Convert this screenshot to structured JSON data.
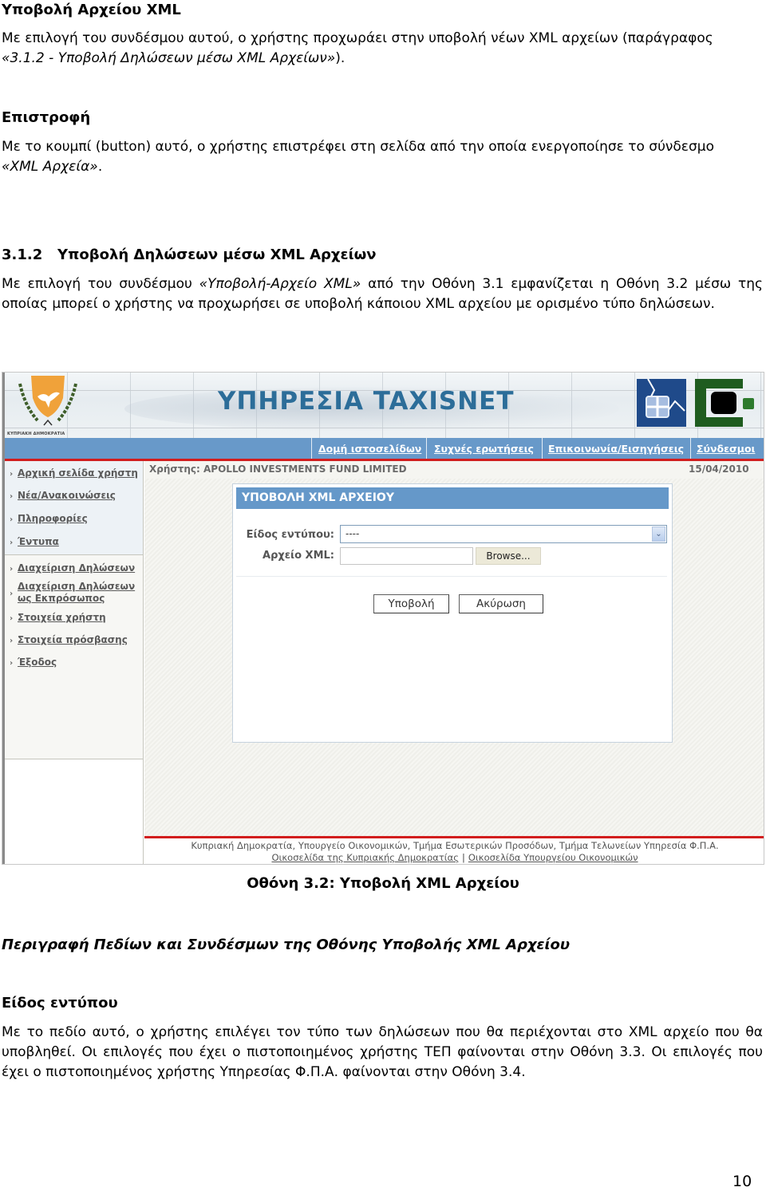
{
  "doc": {
    "sections": [
      {
        "heading": "Υποβολή Αρχείου XML",
        "body_text": "Με επιλογή του συνδέσμου αυτού, ο χρήστης προχωράει στην υποβολή νέων XML αρχείων (παράγραφος",
        "body_ref": "«3.1.2 - Υποβολή Δηλώσεων μέσω XML Αρχείων»",
        "body_end": ")."
      },
      {
        "heading": "Επιστροφή",
        "body_text": "Με το κουμπί (button) αυτό, ο χρήστης επιστρέφει στη σελίδα από την οποία ενεργοποίησε το σύνδεσμο",
        "body_ref": "«XML Αρχεία»",
        "body_end": "."
      }
    ],
    "subsection": {
      "heading": "3.1.2   Υποβολή Δηλώσεων μέσω XML Αρχείων",
      "body_start": "Με επιλογή του συνδέσμου ",
      "body_ref": "«Υποβολή-Αρχείο XML»",
      "body_rest": " από την Οθόνη 3.1 εμφανίζεται η Οθόνη 3.2 μέσω της οποίας μπορεί ο χρήστης να προχωρήσει σε υποβολή κάποιου XML αρχείου με ορισμένο τύπο δηλώσεων."
    },
    "caption": "Οθόνη 3.2: Υποβολή XML Αρχείου",
    "fields_heading": "Περιγραφή Πεδίων και Συνδέσμων της Οθόνης Υποβολής XML Αρχείου",
    "field_section": {
      "heading": "Είδος εντύπου",
      "body": "Με το πεδίο αυτό, ο χρήστης επιλέγει τον τύπο των δηλώσεων που θα περιέχονται στο XML αρχείο που θα υποβληθεί. Οι επιλογές που έχει ο πιστοποιημένος χρήστης ΤΕΠ φαίνονται στην Οθόνη 3.3. Οι επιλογές που έχει ο πιστοποιημένος χρήστης Υπηρεσίας Φ.Π.Α. φαίνονται στην Οθόνη 3.4."
    },
    "page_number": "10"
  },
  "screenshot": {
    "crest_label": "ΚΥΠΡΙΑΚΗ ΔΗΜΟΚΡΑΤΙΑ",
    "site_title": "ΥΠΗΡΕΣΙΑ TAXISNET",
    "nav": [
      {
        "label": "Δομή ιστοσελίδων"
      },
      {
        "label": "Συχνές ερωτήσεις"
      },
      {
        "label": "Επικοινωνία/Εισηγήσεις"
      },
      {
        "label": "Σύνδεσμοι"
      }
    ],
    "sidebar": [
      {
        "label": "Αρχική σελίδα χρήστη"
      },
      {
        "label": "Νέα/Ανακοινώσεις"
      },
      {
        "label": "Πληροφορίες"
      },
      {
        "label": "Έντυπα"
      },
      {
        "label": "Διαχείριση Δηλώσεων"
      },
      {
        "label": "Διαχείριση Δηλώσεων",
        "label2": "ως Εκπρόσωπος"
      },
      {
        "label": "Στοιχεία χρήστη"
      },
      {
        "label": "Στοιχεία πρόσβασης"
      },
      {
        "label": "Έξοδος"
      }
    ],
    "user_label": "Χρήστης: APOLLO INVESTMENTS FUND LIMITED",
    "date": "15/04/2010",
    "panel_title": "ΥΠΟΒΟΛΗ XML ΑΡΧΕΙΟΥ",
    "form": {
      "type_label": "Είδος εντύπου:",
      "type_value": "----",
      "file_label": "Αρχείο XML:",
      "file_value": "",
      "browse_label": "Browse...",
      "submit_label": "Υποβολή",
      "cancel_label": "Ακύρωση"
    },
    "footer": {
      "line1": "Κυπριακή Δημοκρατία, Υπουργείο Οικονομικών, Τμήμα Εσωτερικών Προσόδων, Τμήμα Τελωνείων Υπηρεσία Φ.Π.Α.",
      "link1": "Οικοσελίδα της Κυπριακής Δημοκρατίας",
      "separator": "|",
      "link2": "Οικοσελίδα Υπουργείου Οικονομικών"
    },
    "colors": {
      "nav_blue": "#6899c9",
      "accent_red": "#d21d1d",
      "title_blue": "#2c6d99",
      "crest_orange": "#f0a23a",
      "logo_blue": "#1f4a8a",
      "logo_green": "#1f5c1f"
    }
  }
}
